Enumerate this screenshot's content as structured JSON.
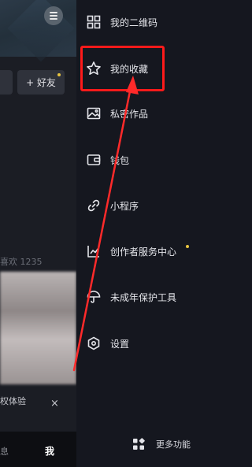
{
  "profile": {
    "add_friend": "+ 好友",
    "likes_text": "喜欢 1235",
    "trial_text": "权体验",
    "trial_close": "×",
    "tab_message": "息",
    "tab_me": "我"
  },
  "drawer": {
    "items": [
      {
        "label": "我的二维码",
        "icon": "qrcode-icon"
      },
      {
        "label": "我的收藏",
        "icon": "star-icon"
      },
      {
        "label": "私密作品",
        "icon": "image-icon"
      },
      {
        "label": "钱包",
        "icon": "wallet-icon"
      },
      {
        "label": "小程序",
        "icon": "link-icon"
      },
      {
        "label": "创作者服务中心",
        "icon": "chart-icon"
      },
      {
        "label": "未成年保护工具",
        "icon": "umbrella-icon"
      },
      {
        "label": "设置",
        "icon": "settings-icon"
      }
    ],
    "more": {
      "label": "更多功能",
      "icon": "grid-icon"
    }
  },
  "colors": {
    "drawer_bg": "#15171f",
    "highlight": "#ff1a1a",
    "notification_dot": "#e8c440"
  }
}
